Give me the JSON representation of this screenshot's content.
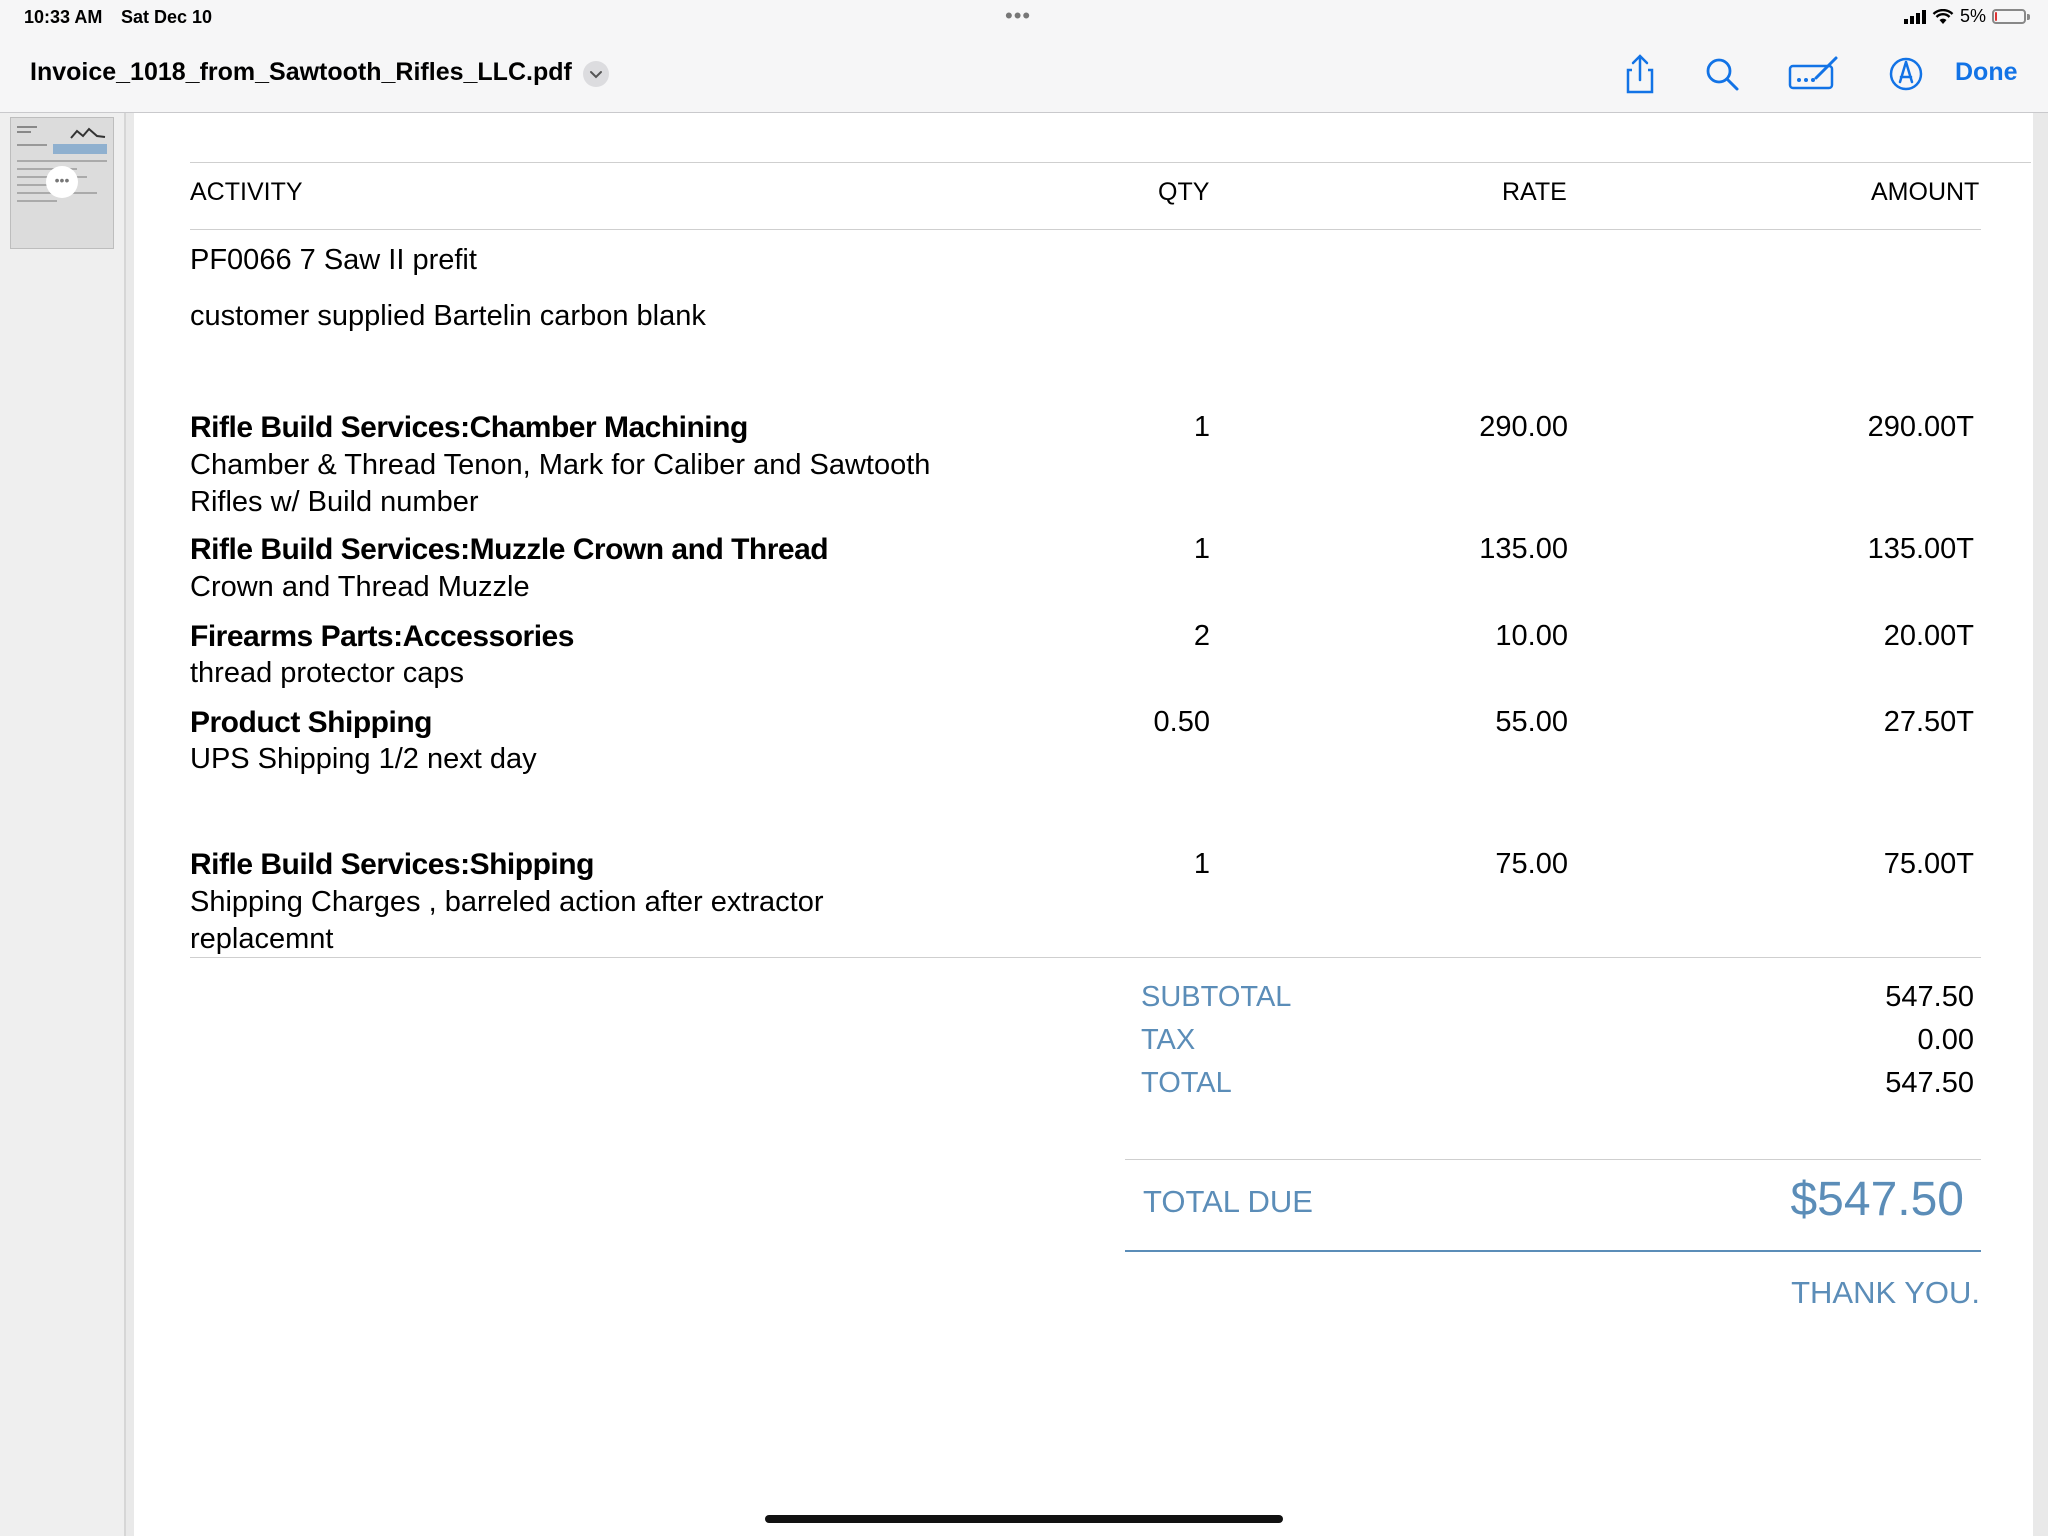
{
  "status_bar": {
    "time": "10:33 AM",
    "date": "Sat Dec 10",
    "battery": "5%",
    "battery_level": 0.05,
    "menu_dots": "•••"
  },
  "toolbar": {
    "file_name": "Invoice_1018_from_Sawtooth_Rifles_LLC.pdf",
    "done_label": "Done",
    "icons": [
      "chevron-down-icon",
      "share-icon",
      "search-icon",
      "markup-icon",
      "pencil-tip-icon"
    ]
  },
  "sidebar": {
    "thumbnail_icon": "more-dots-icon"
  },
  "table": {
    "headers": {
      "activity": "ACTIVITY",
      "qty": "QTY",
      "rate": "RATE",
      "amount": "AMOUNT"
    },
    "intro": [
      "PF0066 7 Saw II prefit",
      "customer supplied Bartelin carbon blank"
    ],
    "rows": [
      {
        "name": "Rifle Build Services:Chamber Machining",
        "desc1": "Chamber & Thread Tenon, Mark for Caliber and Sawtooth",
        "desc2": "Rifles w/ Build number",
        "qty": "1",
        "rate": "290.00",
        "amount": "290.00T"
      },
      {
        "name": "Rifle Build Services:Muzzle Crown and Thread",
        "desc1": "Crown and Thread Muzzle",
        "desc2": "",
        "qty": "1",
        "rate": "135.00",
        "amount": "135.00T"
      },
      {
        "name": "Firearms Parts:Accessories",
        "desc1": "thread protector caps",
        "desc2": "",
        "qty": "2",
        "rate": "10.00",
        "amount": "20.00T"
      },
      {
        "name": "Product Shipping",
        "desc1": "UPS Shipping  1/2 next day",
        "desc2": "",
        "qty": "0.50",
        "rate": "55.00",
        "amount": "27.50T"
      },
      {
        "name": "Rifle Build Services:Shipping",
        "desc1": "Shipping Charges , barreled action after extractor",
        "desc2": "replacemnt",
        "qty": "1",
        "rate": "75.00",
        "amount": "75.00T"
      }
    ]
  },
  "totals": {
    "subtotal_label": "SUBTOTAL",
    "subtotal": "547.50",
    "tax_label": "TAX",
    "tax": "0.00",
    "total_label": "TOTAL",
    "total": "547.50",
    "total_due_label": "TOTAL DUE",
    "total_due": "$547.50",
    "thank_you": "THANK YOU."
  },
  "colors": {
    "accent_blue": "#5b8db8",
    "link_blue": "#1273e6"
  }
}
